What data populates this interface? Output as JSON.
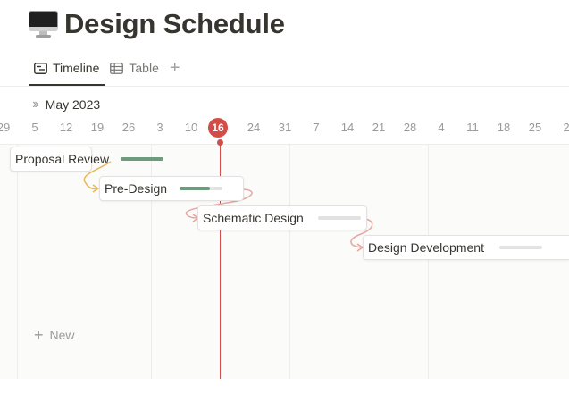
{
  "page": {
    "emoji_icon": "desktop-computer-icon",
    "title": "Design Schedule"
  },
  "tabs": [
    {
      "label": "Timeline",
      "icon": "timeline-icon",
      "active": true
    },
    {
      "label": "Table",
      "icon": "table-icon",
      "active": false
    }
  ],
  "tab_add_label": "+",
  "timeline": {
    "month_label": "May 2023",
    "nav_icon": "double-chevron-right-icon",
    "dates": [
      "29",
      "5",
      "12",
      "19",
      "26",
      "3",
      "10",
      "16",
      "24",
      "31",
      "7",
      "14",
      "21",
      "28",
      "4",
      "11",
      "18",
      "25",
      "2"
    ],
    "today_label": "16",
    "accent_color": "#d44c47"
  },
  "tasks": [
    {
      "label": "Proposal Review",
      "progress": 1.0
    },
    {
      "label": "Pre-Design",
      "progress": 0.7
    },
    {
      "label": "Schematic Design",
      "progress": 0.0
    },
    {
      "label": "Design Development",
      "progress": 0.0
    }
  ],
  "colors": {
    "progress_fill": "#6c9b7d",
    "progress_track": "#e3e2e0",
    "dep_ok": "#e8b85a",
    "dep_warn": "#e5a79f"
  },
  "new_label": "New"
}
